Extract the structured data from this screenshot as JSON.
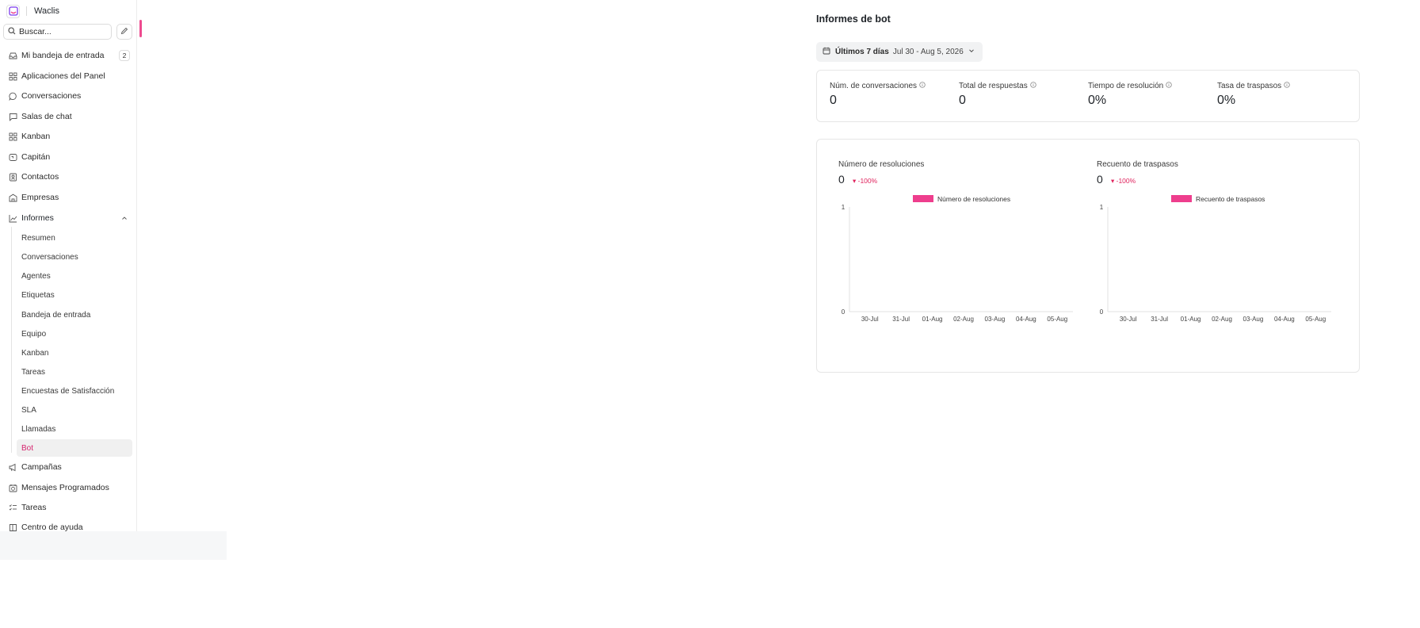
{
  "sidebar": {
    "brand": {
      "name": "Waclis"
    },
    "search": {
      "placeholder": "Buscar..."
    },
    "items": [
      {
        "label": "Mi bandeja de entrada",
        "icon": "inbox-icon",
        "badge": "2"
      },
      {
        "label": "Aplicaciones del Panel",
        "icon": "apps-icon"
      },
      {
        "label": "Conversaciones",
        "icon": "chat-bubble-icon"
      },
      {
        "label": "Salas de chat",
        "icon": "chat-square-icon"
      },
      {
        "label": "Kanban",
        "icon": "grid-icon"
      },
      {
        "label": "Capitán",
        "icon": "bot-icon"
      },
      {
        "label": "Contactos",
        "icon": "contact-icon"
      },
      {
        "label": "Empresas",
        "icon": "building-icon"
      },
      {
        "label": "Informes",
        "icon": "chart-line-icon"
      }
    ],
    "reports_sub": [
      {
        "label": "Resumen"
      },
      {
        "label": "Conversaciones"
      },
      {
        "label": "Agentes"
      },
      {
        "label": "Etiquetas"
      },
      {
        "label": "Bandeja de entrada"
      },
      {
        "label": "Equipo"
      },
      {
        "label": "Kanban"
      },
      {
        "label": "Tareas"
      },
      {
        "label": "Encuestas de Satisfacción"
      },
      {
        "label": "SLA"
      },
      {
        "label": "Llamadas"
      },
      {
        "label": "Bot"
      }
    ],
    "items_after": [
      {
        "label": "Campañas",
        "icon": "megaphone-icon"
      },
      {
        "label": "Mensajes Programados",
        "icon": "calendar-clock-icon"
      },
      {
        "label": "Tareas",
        "icon": "list-check-icon"
      },
      {
        "label": "Centro de ayuda",
        "icon": "book-icon"
      }
    ]
  },
  "main": {
    "title": "Informes de bot",
    "date_filter": {
      "label": "Últimos 7 días",
      "range": "Jul 30 - Aug 5, 2026"
    },
    "metrics": [
      {
        "label": "Núm. de conversaciones",
        "value": "0"
      },
      {
        "label": "Total de respuestas",
        "value": "0"
      },
      {
        "label": "Tiempo de resolución",
        "value": "0%"
      },
      {
        "label": "Tasa de traspasos",
        "value": "0%"
      }
    ]
  },
  "colors": {
    "accent": "#ee3e8d",
    "negative": "#e0245e"
  },
  "chart_data": [
    {
      "type": "bar",
      "title": "Número de resoluciones",
      "summary_value": "0",
      "change": "▾ -100%",
      "legend": "Número de resoluciones",
      "legend_position": "top-center",
      "categories": [
        "30-Jul",
        "31-Jul",
        "01-Aug",
        "02-Aug",
        "03-Aug",
        "04-Aug",
        "05-Aug"
      ],
      "series": [
        {
          "name": "Número de resoluciones",
          "values": [
            0,
            0,
            0,
            0,
            0,
            0,
            0
          ]
        }
      ],
      "yticks": [
        "0",
        "1"
      ],
      "ylim": [
        0,
        1
      ],
      "grid": false
    },
    {
      "type": "bar",
      "title": "Recuento de traspasos",
      "summary_value": "0",
      "change": "▾ -100%",
      "legend": "Recuento de traspasos",
      "legend_position": "top-center",
      "categories": [
        "30-Jul",
        "31-Jul",
        "01-Aug",
        "02-Aug",
        "03-Aug",
        "04-Aug",
        "05-Aug"
      ],
      "series": [
        {
          "name": "Recuento de traspasos",
          "values": [
            0,
            0,
            0,
            0,
            0,
            0,
            0
          ]
        }
      ],
      "yticks": [
        "0",
        "1"
      ],
      "ylim": [
        0,
        1
      ],
      "grid": false
    }
  ]
}
